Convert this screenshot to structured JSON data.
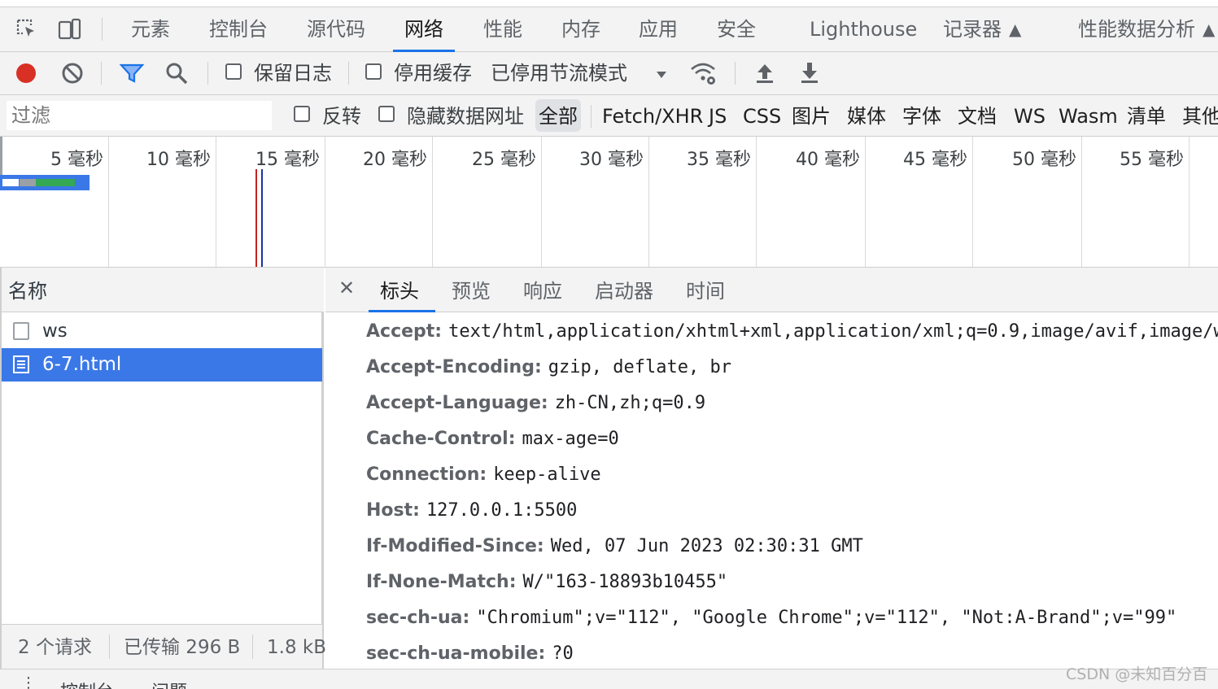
{
  "panel_tabs": [
    {
      "label": "元素"
    },
    {
      "label": "控制台"
    },
    {
      "label": "源代码"
    },
    {
      "label": "网络"
    },
    {
      "label": "性能"
    },
    {
      "label": "内存"
    },
    {
      "label": "应用"
    },
    {
      "label": "安全"
    },
    {
      "label": "Lighthouse"
    },
    {
      "label": "记录器"
    },
    {
      "label": "性能数据分析"
    }
  ],
  "active_panel": "网络",
  "toolbar": {
    "preserve_log_label": "保留日志",
    "disable_cache_label": "停用缓存",
    "throttling_value": "已停用节流模式",
    "record_color": "#d93025"
  },
  "filter": {
    "placeholder": "过滤",
    "invert_label": "反转",
    "hide_data_urls_label": "隐藏数据网址",
    "types": [
      "全部",
      "Fetch/XHR",
      "JS",
      "CSS",
      "图片",
      "媒体",
      "字体",
      "文档",
      "WS",
      "Wasm",
      "清单",
      "其他"
    ],
    "selected_type": "全部"
  },
  "overview": {
    "ticks": [
      "5 毫秒",
      "10 毫秒",
      "15 毫秒",
      "20 毫秒",
      "25 毫秒",
      "30 毫秒",
      "35 毫秒",
      "40 毫秒",
      "45 毫秒",
      "50 毫秒",
      "55 毫秒"
    ]
  },
  "request_list": {
    "header": "名称",
    "rows": [
      {
        "name": "ws",
        "selected": false
      },
      {
        "name": "6-7.html",
        "selected": true
      }
    ]
  },
  "status": {
    "requests": "2 个请求",
    "transferred": "已传输 296 B",
    "resources": "1.8 kB"
  },
  "detail_tabs": [
    "标头",
    "预览",
    "响应",
    "启动器",
    "时间"
  ],
  "active_detail_tab": "标头",
  "headers": [
    {
      "key": "Accept:",
      "value": "text/html,application/xhtml+xml,application/xml;q=0.9,image/avif,image/w"
    },
    {
      "key": "Accept-Encoding:",
      "value": "gzip, deflate, br"
    },
    {
      "key": "Accept-Language:",
      "value": "zh-CN,zh;q=0.9"
    },
    {
      "key": "Cache-Control:",
      "value": "max-age=0"
    },
    {
      "key": "Connection:",
      "value": "keep-alive"
    },
    {
      "key": "Host:",
      "value": "127.0.0.1:5500"
    },
    {
      "key": "If-Modified-Since:",
      "value": "Wed, 07 Jun 2023 02:30:31 GMT"
    },
    {
      "key": "If-None-Match:",
      "value": "W/\"163-18893b10455\""
    },
    {
      "key": "sec-ch-ua:",
      "value": "\"Chromium\";v=\"112\", \"Google Chrome\";v=\"112\", \"Not:A-Brand\";v=\"99\""
    },
    {
      "key": "sec-ch-ua-mobile:",
      "value": "?0"
    }
  ],
  "drawer": {
    "tab1": "控制台",
    "tab2": "问题"
  },
  "watermark": "CSDN @未知百分百"
}
